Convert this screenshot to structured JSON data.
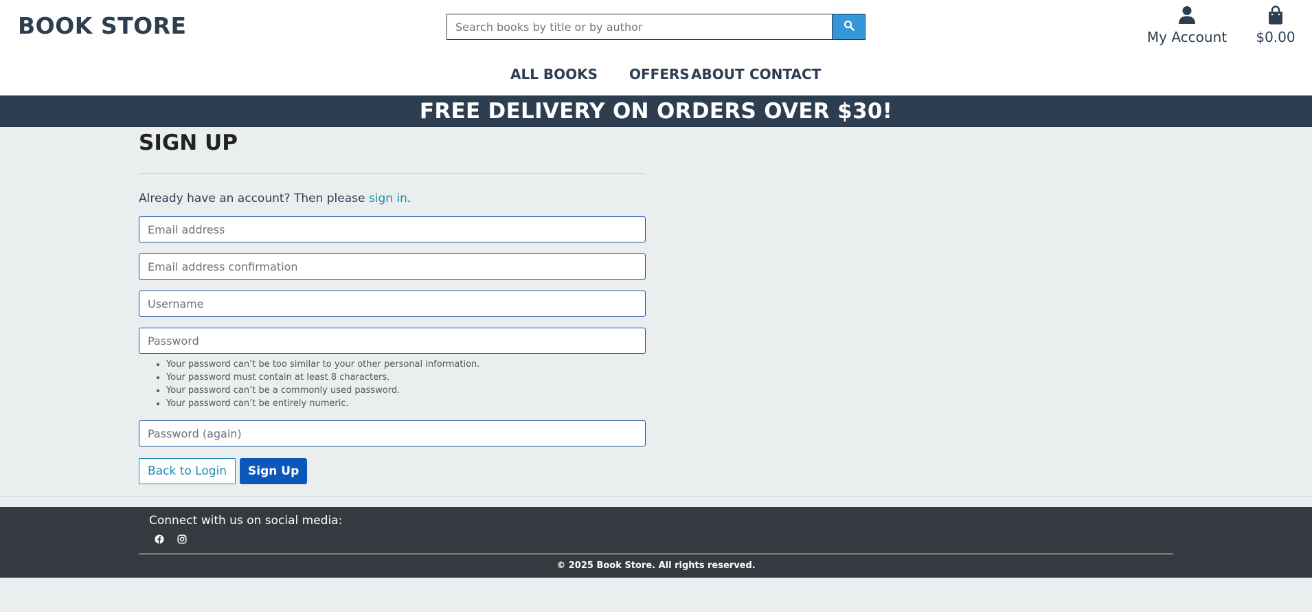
{
  "header": {
    "logo": "BOOK STORE",
    "search_placeholder": "Search books by title or by author",
    "account_label": "My Account",
    "cart_total": "$0.00"
  },
  "nav": {
    "all_books": "ALL BOOKS",
    "offers": "OFFERS",
    "about": "ABOUT",
    "contact": "CONTACT"
  },
  "banner": {
    "text": "FREE DELIVERY ON ORDERS OVER $30!"
  },
  "signup": {
    "title": "SIGN UP",
    "note_prefix": "Already have an account? Then please ",
    "note_link": "sign in",
    "note_suffix": ".",
    "email_placeholder": "Email address",
    "email_confirm_placeholder": "Email address confirmation",
    "username_placeholder": "Username",
    "password_placeholder": "Password",
    "password_help": [
      "Your password can’t be too similar to your other personal information.",
      "Your password must contain at least 8 characters.",
      "Your password can’t be a commonly used password.",
      "Your password can’t be entirely numeric."
    ],
    "password_again_placeholder": "Password (again)",
    "back_button": "Back to Login",
    "submit_button": "Sign Up"
  },
  "footer": {
    "social_title": "Connect with us on social media:",
    "icons": [
      "facebook-icon",
      "instagram-icon"
    ],
    "copyright": "© 2025 Book Store. All rights reserved."
  },
  "colors": {
    "brand_dark": "#2c3e50",
    "search_button": "#3596d8",
    "link": "#1a8fb0",
    "primary_button": "#0d57b8",
    "footer_bg": "#343a40"
  }
}
